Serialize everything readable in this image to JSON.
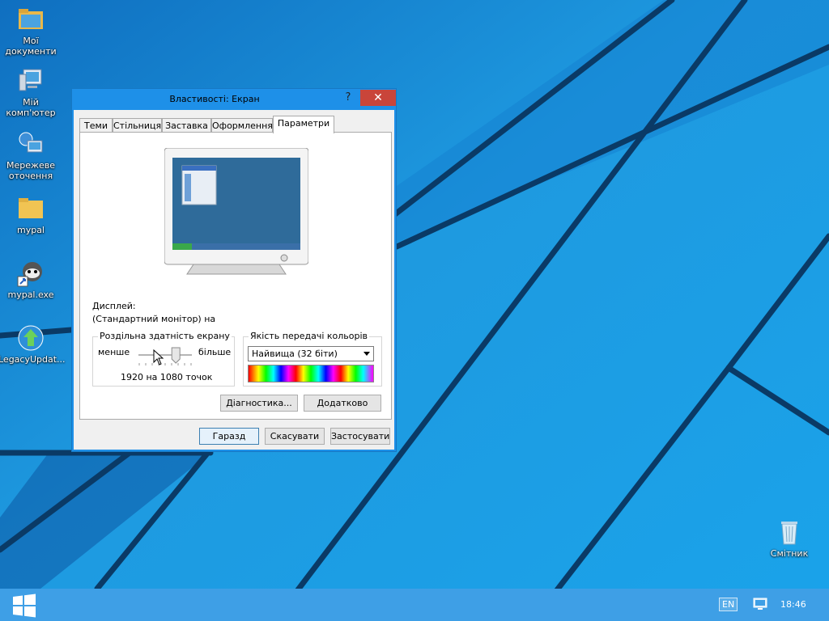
{
  "desktop": {
    "icons": [
      {
        "label": "Мої документи",
        "icon": "folder-documents-icon"
      },
      {
        "label": "Мій комп'ютер",
        "icon": "computer-icon"
      },
      {
        "label": "Мережеве оточення",
        "icon": "network-icon"
      },
      {
        "label": "mypal",
        "icon": "folder-icon"
      },
      {
        "label": "mypal.exe",
        "icon": "raccoon-app-icon"
      },
      {
        "label": "LegacyUpdat...",
        "icon": "update-globe-icon"
      },
      {
        "label": "Смітник",
        "icon": "recycle-bin-icon"
      }
    ]
  },
  "dialog": {
    "title": "Властивості: Екран",
    "help": "?",
    "close": "✕",
    "tabs": [
      "Теми",
      "Стільниця",
      "Заставка",
      "Оформлення",
      "Параметри"
    ],
    "active_tab": "Параметри",
    "display_label": "Дисплей:",
    "display_value": "(Стандартний монітор) на",
    "resolution": {
      "title": "Роздільна здатність екрану",
      "less": "менше",
      "more": "більше",
      "value": "1920 на 1080 точок",
      "slider_fraction": 0.7
    },
    "color_quality": {
      "title": "Якість передачі кольорів",
      "selected": "Найвища (32 біти)"
    },
    "buttons": {
      "diagnostics": "Діагностика...",
      "advanced": "Додатково",
      "ok": "Гаразд",
      "cancel": "Скасувати",
      "apply": "Застосувати"
    }
  },
  "taskbar": {
    "language": "EN",
    "time": "18:46"
  },
  "colors": {
    "wallpaper": "#1a8fd6",
    "taskbar": "#3e9fe6",
    "close_button": "#c9453a"
  }
}
